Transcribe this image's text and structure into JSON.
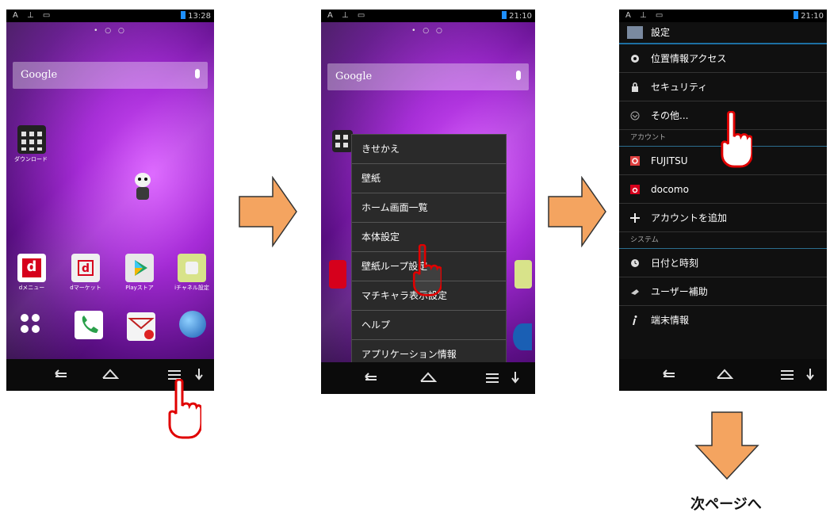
{
  "status": {
    "phone1_time": "13:28",
    "phone2_time": "21:10",
    "phone3_time": "21:10",
    "left_icons": "A ⊥ ▭"
  },
  "home": {
    "search_label": "Google",
    "page_dots": "• ○ ○",
    "download_label": "ダウンロード",
    "dock_labels": [
      "dメニュー",
      "dマーケット",
      "Playストア",
      "iチャネル設定"
    ]
  },
  "menu": {
    "items": [
      "きせかえ",
      "壁紙",
      "ホーム画面一覧",
      "本体設定",
      "壁紙ループ設定",
      "マチキャラ表示設定",
      "ヘルプ",
      "アプリケーション情報"
    ]
  },
  "settings": {
    "title": "設定",
    "rows_top": [
      "位置情報アクセス",
      "セキュリティ",
      "その他..."
    ],
    "account_header": "アカウント",
    "accounts": [
      "FUJITSU",
      "docomo",
      "アカウントを追加"
    ],
    "system_header": "システム",
    "system_rows": [
      "日付と時刻",
      "ユーザー補助",
      "端末情報"
    ]
  },
  "footer": {
    "next_page": "次ページへ"
  },
  "colors": {
    "arrow": "#f4a460",
    "hand": "#e00000",
    "accent": "#1d6fa3"
  }
}
